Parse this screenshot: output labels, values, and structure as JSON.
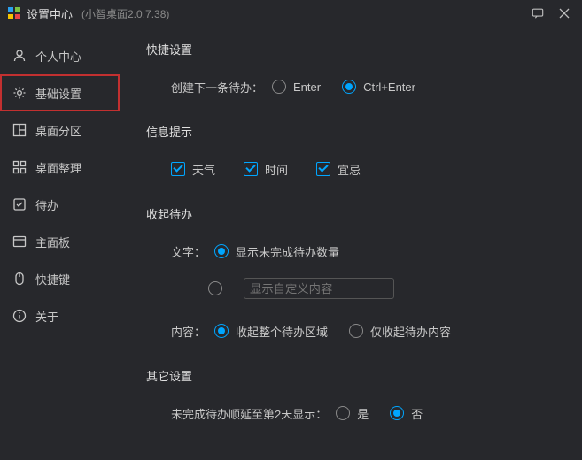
{
  "titlebar": {
    "title": "设置中心",
    "subtitle": "(小智桌面2.0.7.38)"
  },
  "sidebar": {
    "items": [
      {
        "label": "个人中心"
      },
      {
        "label": "基础设置"
      },
      {
        "label": "桌面分区"
      },
      {
        "label": "桌面整理"
      },
      {
        "label": "待办"
      },
      {
        "label": "主面板"
      },
      {
        "label": "快捷键"
      },
      {
        "label": "关于"
      }
    ]
  },
  "sections": {
    "quick": {
      "title": "快捷设置",
      "createNext": {
        "label": "创建下一条待办：",
        "options": {
          "enter": "Enter",
          "ctrlEnter": "Ctrl+Enter"
        }
      }
    },
    "info": {
      "title": "信息提示",
      "checks": {
        "weather": "天气",
        "time": "时间",
        "yiji": "宜忌"
      }
    },
    "collapse": {
      "title": "收起待办",
      "text": {
        "label": "文字：",
        "showCount": "显示未完成待办数量",
        "showCustom": "显示自定义内容",
        "customValue": ""
      },
      "content": {
        "label": "内容：",
        "whole": "收起整个待办区域",
        "onlyContent": "仅收起待办内容"
      }
    },
    "other": {
      "title": "其它设置",
      "delay": {
        "label": "未完成待办顺延至第2天显示：",
        "yes": "是",
        "no": "否"
      }
    }
  }
}
